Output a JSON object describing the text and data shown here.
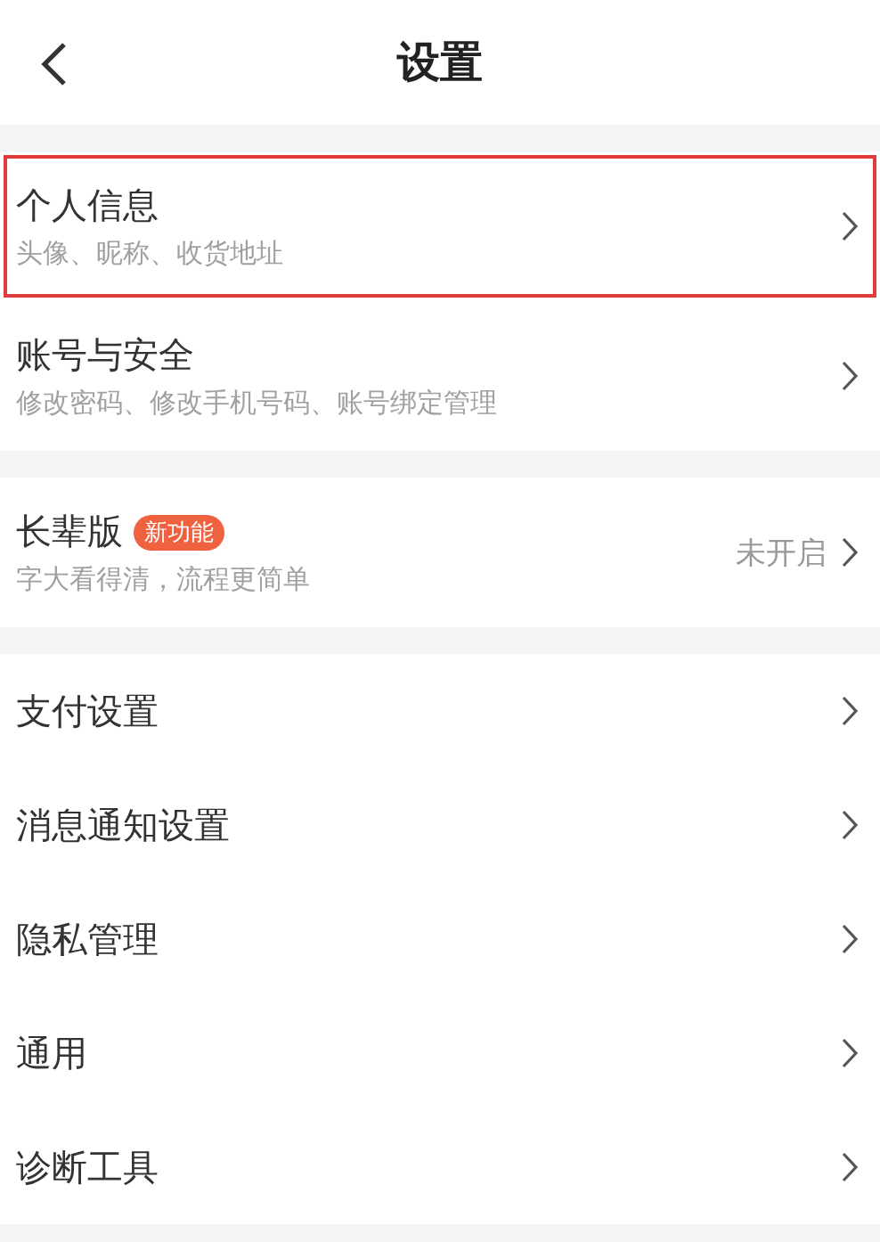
{
  "header": {
    "title": "设置"
  },
  "groups": [
    {
      "items": [
        {
          "title": "个人信息",
          "subtitle": "头像、昵称、收货地址",
          "highlighted": true
        },
        {
          "title": "账号与安全",
          "subtitle": "修改密码、修改手机号码、账号绑定管理",
          "highlighted": false
        }
      ]
    },
    {
      "items": [
        {
          "title": "长辈版",
          "badge": "新功能",
          "subtitle": "字大看得清，流程更简单",
          "value": "未开启",
          "highlighted": false
        }
      ]
    },
    {
      "items": [
        {
          "title": "支付设置",
          "highlighted": false
        },
        {
          "title": "消息通知设置",
          "highlighted": false
        },
        {
          "title": "隐私管理",
          "highlighted": false
        },
        {
          "title": "通用",
          "highlighted": false
        },
        {
          "title": "诊断工具",
          "highlighted": false
        }
      ]
    }
  ]
}
